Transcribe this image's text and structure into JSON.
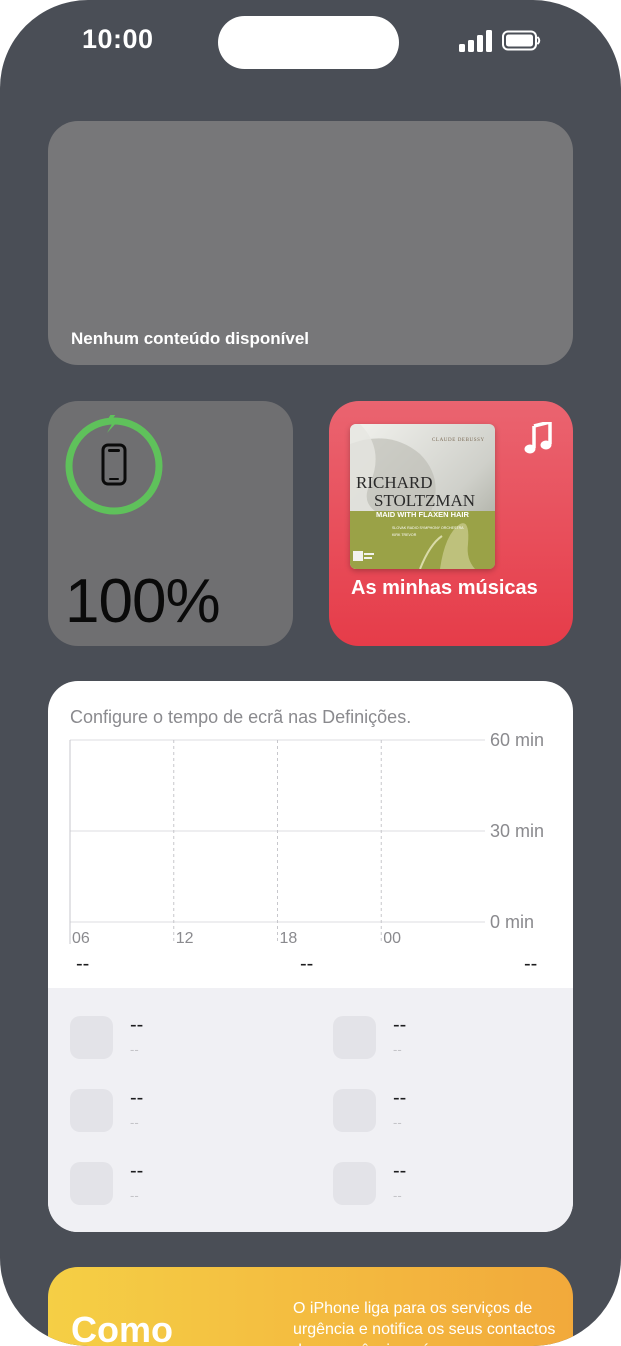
{
  "status_bar": {
    "time": "10:00"
  },
  "empty_widget": {
    "label": "Nenhum conteúdo disponível"
  },
  "battery_widget": {
    "percent": "100%",
    "level": 1.0,
    "ring_color": "#5fc15b"
  },
  "music_widget": {
    "title": "As minhas músicas",
    "accent": "#e63c49",
    "album": {
      "composer": "CLAUDE DEBUSSY",
      "artist_line1": "RICHARD",
      "artist_line2": "STOLTZMAN",
      "album_title": "MAID WITH FLAXEN HAIR",
      "credit1": "SLOVAK RADIO SYMPHONY ORCHESTRA",
      "credit2": "KIRK TREVOR"
    }
  },
  "screen_time_widget": {
    "message": "Configure o tempo de ecrã nas Definições.",
    "y_labels": [
      "60 min",
      "30 min",
      "0 min"
    ],
    "x_labels": [
      "06",
      "12",
      "18",
      "00"
    ],
    "totals": [
      "--",
      "--",
      "--"
    ],
    "apps": [
      {
        "name": "--",
        "time": "--"
      },
      {
        "name": "--",
        "time": "--"
      },
      {
        "name": "--",
        "time": "--"
      },
      {
        "name": "--",
        "time": "--"
      },
      {
        "name": "--",
        "time": "--"
      },
      {
        "name": "--",
        "time": "--"
      }
    ]
  },
  "sos_widget": {
    "title": "Como",
    "text": "O iPhone liga para os serviços de urgência e notifica os seus contactos de emergência após"
  }
}
